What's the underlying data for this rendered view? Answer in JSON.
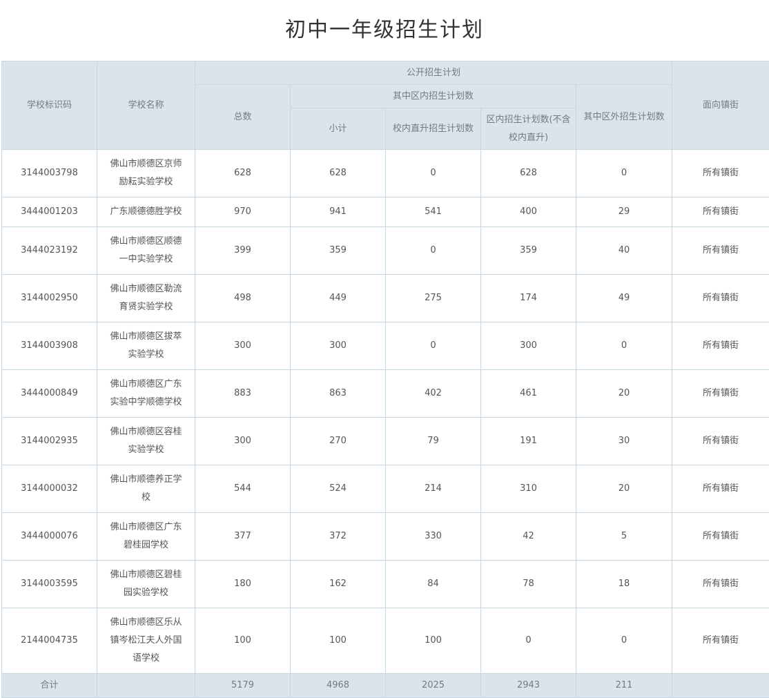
{
  "title": "初中一年级招生计划",
  "header": {
    "school_code": "学校标识码",
    "school_name": "学校名称",
    "public_plan": "公开招生计划",
    "total": "总数",
    "in_district": "其中区内招生计划数",
    "subtotal": "小计",
    "direct_promotion": "校内直升招生计划数",
    "in_district_plan": "区内招生计划数(不含校内直升)",
    "out_district": "其中区外招生计划数",
    "target_streets": "面向镇街"
  },
  "rows": [
    {
      "code": "3144003798",
      "name": "佛山市顺德区京师励耘实验学校",
      "total": "628",
      "subtotal": "628",
      "direct": "0",
      "in_district": "628",
      "out_district": "0",
      "streets": "所有镇街"
    },
    {
      "code": "3444001203",
      "name": "广东顺德德胜学校",
      "total": "970",
      "subtotal": "941",
      "direct": "541",
      "in_district": "400",
      "out_district": "29",
      "streets": "所有镇街"
    },
    {
      "code": "3444023192",
      "name": "佛山市顺德区顺德一中实验学校",
      "total": "399",
      "subtotal": "359",
      "direct": "0",
      "in_district": "359",
      "out_district": "40",
      "streets": "所有镇街"
    },
    {
      "code": "3144002950",
      "name": "佛山市顺德区勒流育贤实验学校",
      "total": "498",
      "subtotal": "449",
      "direct": "275",
      "in_district": "174",
      "out_district": "49",
      "streets": "所有镇街"
    },
    {
      "code": "3144003908",
      "name": "佛山市顺德区拔萃实验学校",
      "total": "300",
      "subtotal": "300",
      "direct": "0",
      "in_district": "300",
      "out_district": "0",
      "streets": "所有镇街"
    },
    {
      "code": "3444000849",
      "name": "佛山市顺德区广东实验中学顺德学校",
      "total": "883",
      "subtotal": "863",
      "direct": "402",
      "in_district": "461",
      "out_district": "20",
      "streets": "所有镇街"
    },
    {
      "code": "3144002935",
      "name": "佛山市顺德区容桂实验学校",
      "total": "300",
      "subtotal": "270",
      "direct": "79",
      "in_district": "191",
      "out_district": "30",
      "streets": "所有镇街"
    },
    {
      "code": "3144000032",
      "name": "佛山市顺德养正学校",
      "total": "544",
      "subtotal": "524",
      "direct": "214",
      "in_district": "310",
      "out_district": "20",
      "streets": "所有镇街"
    },
    {
      "code": "3444000076",
      "name": "佛山市顺德区广东碧桂园学校",
      "total": "377",
      "subtotal": "372",
      "direct": "330",
      "in_district": "42",
      "out_district": "5",
      "streets": "所有镇街"
    },
    {
      "code": "3144003595",
      "name": "佛山市顺德区碧桂园实验学校",
      "total": "180",
      "subtotal": "162",
      "direct": "84",
      "in_district": "78",
      "out_district": "18",
      "streets": "所有镇街"
    },
    {
      "code": "2144004735",
      "name": "佛山市顺德区乐从镇岑松江夫人外国语学校",
      "total": "100",
      "subtotal": "100",
      "direct": "100",
      "in_district": "0",
      "out_district": "0",
      "streets": "所有镇街"
    }
  ],
  "footer": {
    "label": "合计",
    "name": "",
    "total": "5179",
    "subtotal": "4968",
    "direct": "2025",
    "in_district": "2943",
    "out_district": "211",
    "streets": ""
  }
}
